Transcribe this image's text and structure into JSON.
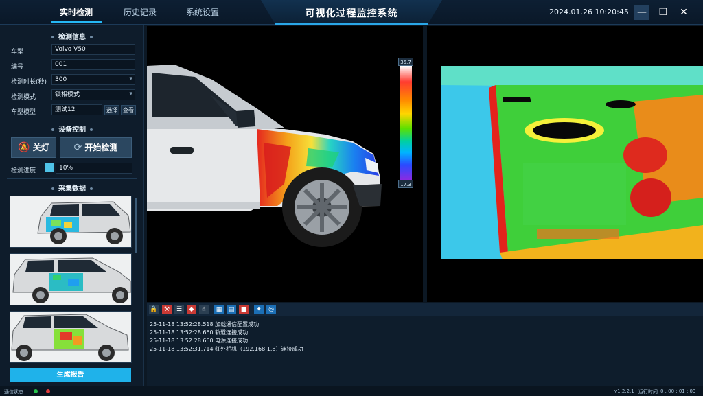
{
  "nav": {
    "tabs": [
      {
        "label": "实时检测",
        "active": true
      },
      {
        "label": "历史记录",
        "active": false
      },
      {
        "label": "系统设置",
        "active": false
      }
    ],
    "title": "可视化过程监控系统",
    "datetime": "2024.01.26 10:20:45",
    "window_controls": {
      "minimize": "—",
      "maximize": "❐",
      "close": "✕"
    }
  },
  "detection_info": {
    "title": "检测信息",
    "fields": [
      {
        "label": "车型",
        "value": "Volvo V50"
      },
      {
        "label": "编号",
        "value": "001"
      },
      {
        "label": "检测时长(秒)",
        "value": "300"
      },
      {
        "label": "检测模式",
        "value": "锁相模式"
      },
      {
        "label": "车型模型",
        "value": "测试12"
      }
    ],
    "select_label": "选择",
    "view_label": "查看"
  },
  "device_control": {
    "title": "设备控制",
    "light_button": "关灯",
    "start_button": "开始检测",
    "progress_label": "检测进度",
    "progress_value": "10%",
    "progress_fraction": 0.1
  },
  "collected_data": {
    "title": "采集数据",
    "report_button": "生成报告"
  },
  "thermal_legend": {
    "max": "35.7",
    "min": "17.3"
  },
  "log": {
    "lines": [
      "25-11-18 13:52:28.518 加载通信配置成功",
      "25-11-18 13:52:28.660 轨道连接成功",
      "25-11-18 13:52:28.660 电源连接成功",
      "25-11-18 13:52:31.714 红外相机（192.168.1.8）连接成功"
    ]
  },
  "status": {
    "comm_label": "通信状态",
    "version": "v1.2.2.1",
    "runtime_label": "运行时间",
    "runtime_value": "0 . 00 : 01 : 03"
  },
  "colors": {
    "accent": "#1fb2ea",
    "background": "#0c1824",
    "panel": "#0e1c2b",
    "status_ok": "#26c24a",
    "status_err": "#e33b3b"
  }
}
